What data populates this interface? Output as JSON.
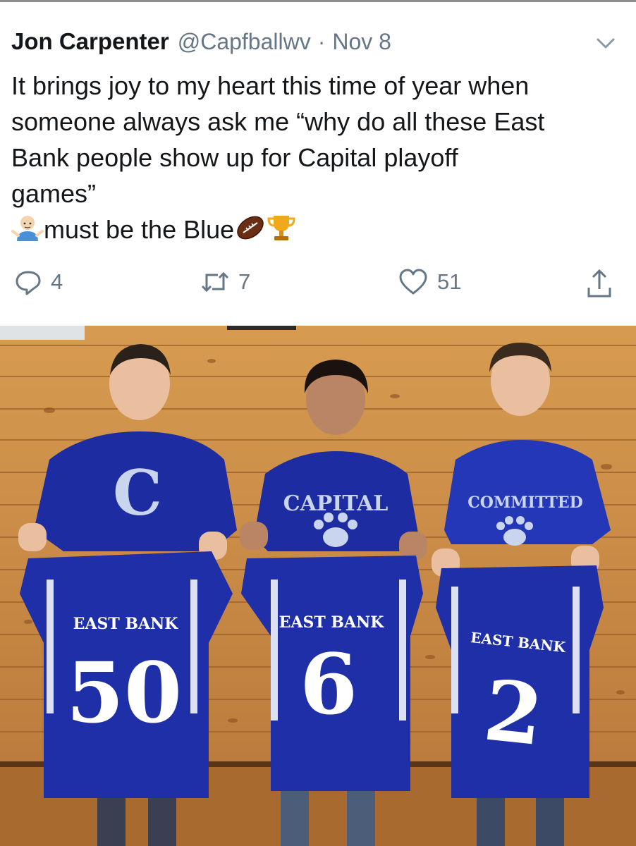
{
  "tweet": {
    "author_name": "Jon Carpenter",
    "handle": "@Capfballwv",
    "separator": "·",
    "date": "Nov 8",
    "text_lines": [
      "It brings joy to my heart this time of year when",
      "someone always ask me “why do all these East",
      "Bank people show up for Capital playoff",
      "games”"
    ],
    "last_line_text": "must be the Blue",
    "emojis": [
      "man-shrugging-emoji",
      "american-football-emoji",
      "trophy-emoji"
    ],
    "actions": {
      "reply_count": "4",
      "retweet_count": "7",
      "like_count": "51"
    }
  },
  "photo": {
    "players": [
      {
        "shirt_text": "C",
        "jersey_team": "EAST BANK",
        "jersey_number": "50"
      },
      {
        "shirt_text": "CAPITAL",
        "jersey_team": "EAST BANK",
        "jersey_number": "6"
      },
      {
        "shirt_text": "COMMITTED",
        "jersey_team": "EAST BANK",
        "jersey_number": "2"
      }
    ]
  },
  "colors": {
    "text": "#14171a",
    "muted": "#657786",
    "jersey_blue": "#1f2fa8",
    "wood": "#c98f45"
  }
}
